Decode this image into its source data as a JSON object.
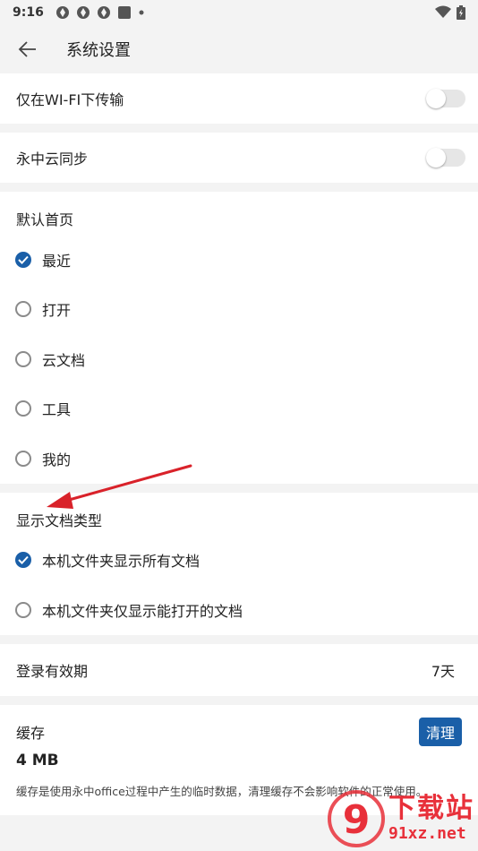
{
  "status_bar": {
    "time": "9:16",
    "icons": [
      "notification-icon",
      "notification-icon",
      "notification-icon",
      "square-icon",
      "dot-icon"
    ],
    "right_icons": [
      "wifi-icon",
      "battery-icon"
    ]
  },
  "header": {
    "title": "系统设置"
  },
  "settings": {
    "wifi_only": {
      "label": "仅在WI-FI下传输",
      "enabled": false
    },
    "cloud_sync": {
      "label": "永中云同步",
      "enabled": false
    }
  },
  "default_home": {
    "title": "默认首页",
    "options": [
      {
        "label": "最近",
        "checked": true
      },
      {
        "label": "打开",
        "checked": false
      },
      {
        "label": "云文档",
        "checked": false
      },
      {
        "label": "工具",
        "checked": false
      },
      {
        "label": "我的",
        "checked": false
      }
    ]
  },
  "doc_types": {
    "title": "显示文档类型",
    "options": [
      {
        "label": "本机文件夹显示所有文档",
        "checked": true
      },
      {
        "label": "本机文件夹仅显示能打开的文档",
        "checked": false
      }
    ]
  },
  "login": {
    "label": "登录有效期",
    "value": "7天"
  },
  "cache": {
    "label": "缓存",
    "size": "4 MB",
    "clear_label": "清理",
    "description": "缓存是使用永中office过程中产生的临时数据，清理缓存不会影响软件的正常使用。"
  },
  "colors": {
    "accent": "#1a5fa8",
    "arrow": "#d9222a",
    "watermark": "#e8303a"
  },
  "watermark": {
    "logo_text": "9",
    "cn": "下载站",
    "url": "91xz.net"
  }
}
